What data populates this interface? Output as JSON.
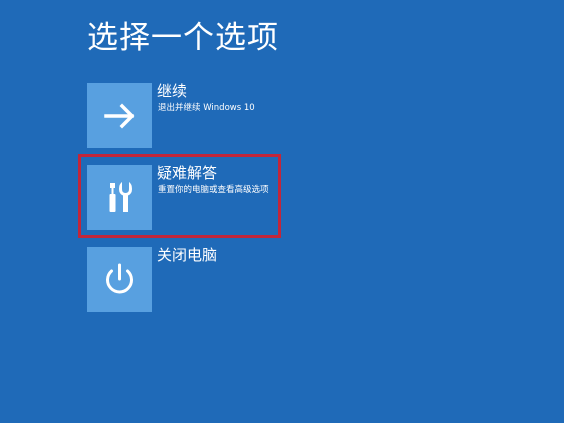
{
  "page": {
    "title": "选择一个选项",
    "background_color": "#1f6ab8",
    "tile_color": "#58a0e0",
    "highlight_color": "#c2263a"
  },
  "options": [
    {
      "label": "继续",
      "description": "退出并继续 Windows 10",
      "icon": "arrow-right-icon"
    },
    {
      "label": "疑难解答",
      "description": "重置你的电脑或查看高级选项",
      "icon": "tools-icon",
      "highlighted": true
    },
    {
      "label": "关闭电脑",
      "description": "",
      "icon": "power-icon"
    }
  ]
}
